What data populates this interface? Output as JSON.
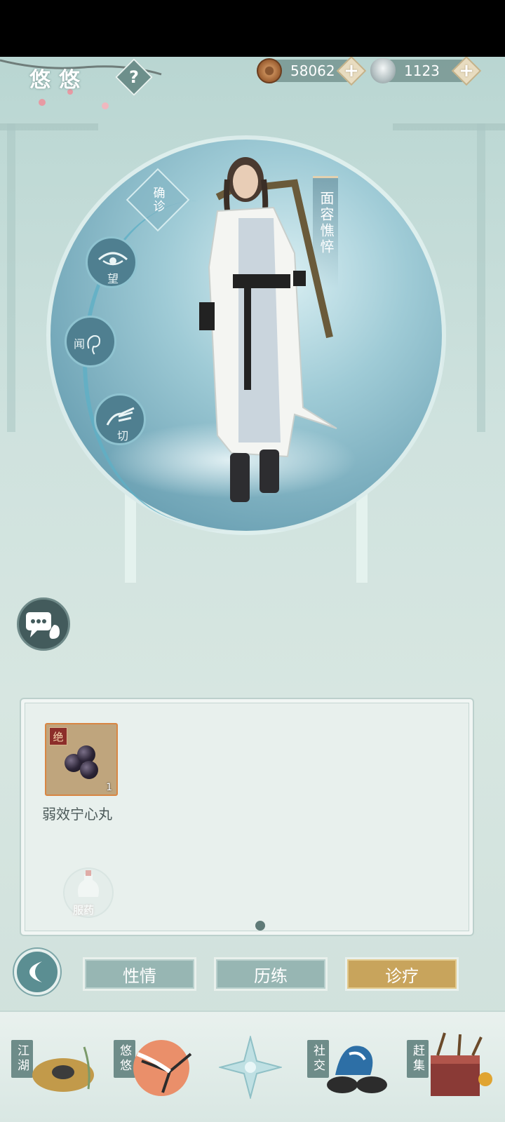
{
  "header": {
    "player_name": "悠悠",
    "help_label": "?",
    "copper_coins": "58062",
    "silver_ingots": "1123",
    "plus_label": "+"
  },
  "diagnosis": {
    "confirm_label": "确诊",
    "look_label": "望",
    "listen_label": "闻",
    "pulse_label": "切",
    "symptom": "面容憔悴"
  },
  "items": [
    {
      "name": "弱效宁心丸",
      "grade": "绝",
      "count": "1"
    }
  ],
  "medicine_button": "服药",
  "tabs": [
    {
      "label": "性情",
      "active": false
    },
    {
      "label": "历练",
      "active": false
    },
    {
      "label": "诊疗",
      "active": true
    }
  ],
  "nav": {
    "jianghu": "江湖",
    "youyou": "悠悠",
    "social": "社交",
    "market": "赶集"
  },
  "colors": {
    "active_tab": "#c8a45c",
    "inactive_tab": "#97b6b3",
    "scene_bg": "#cfe2de"
  }
}
